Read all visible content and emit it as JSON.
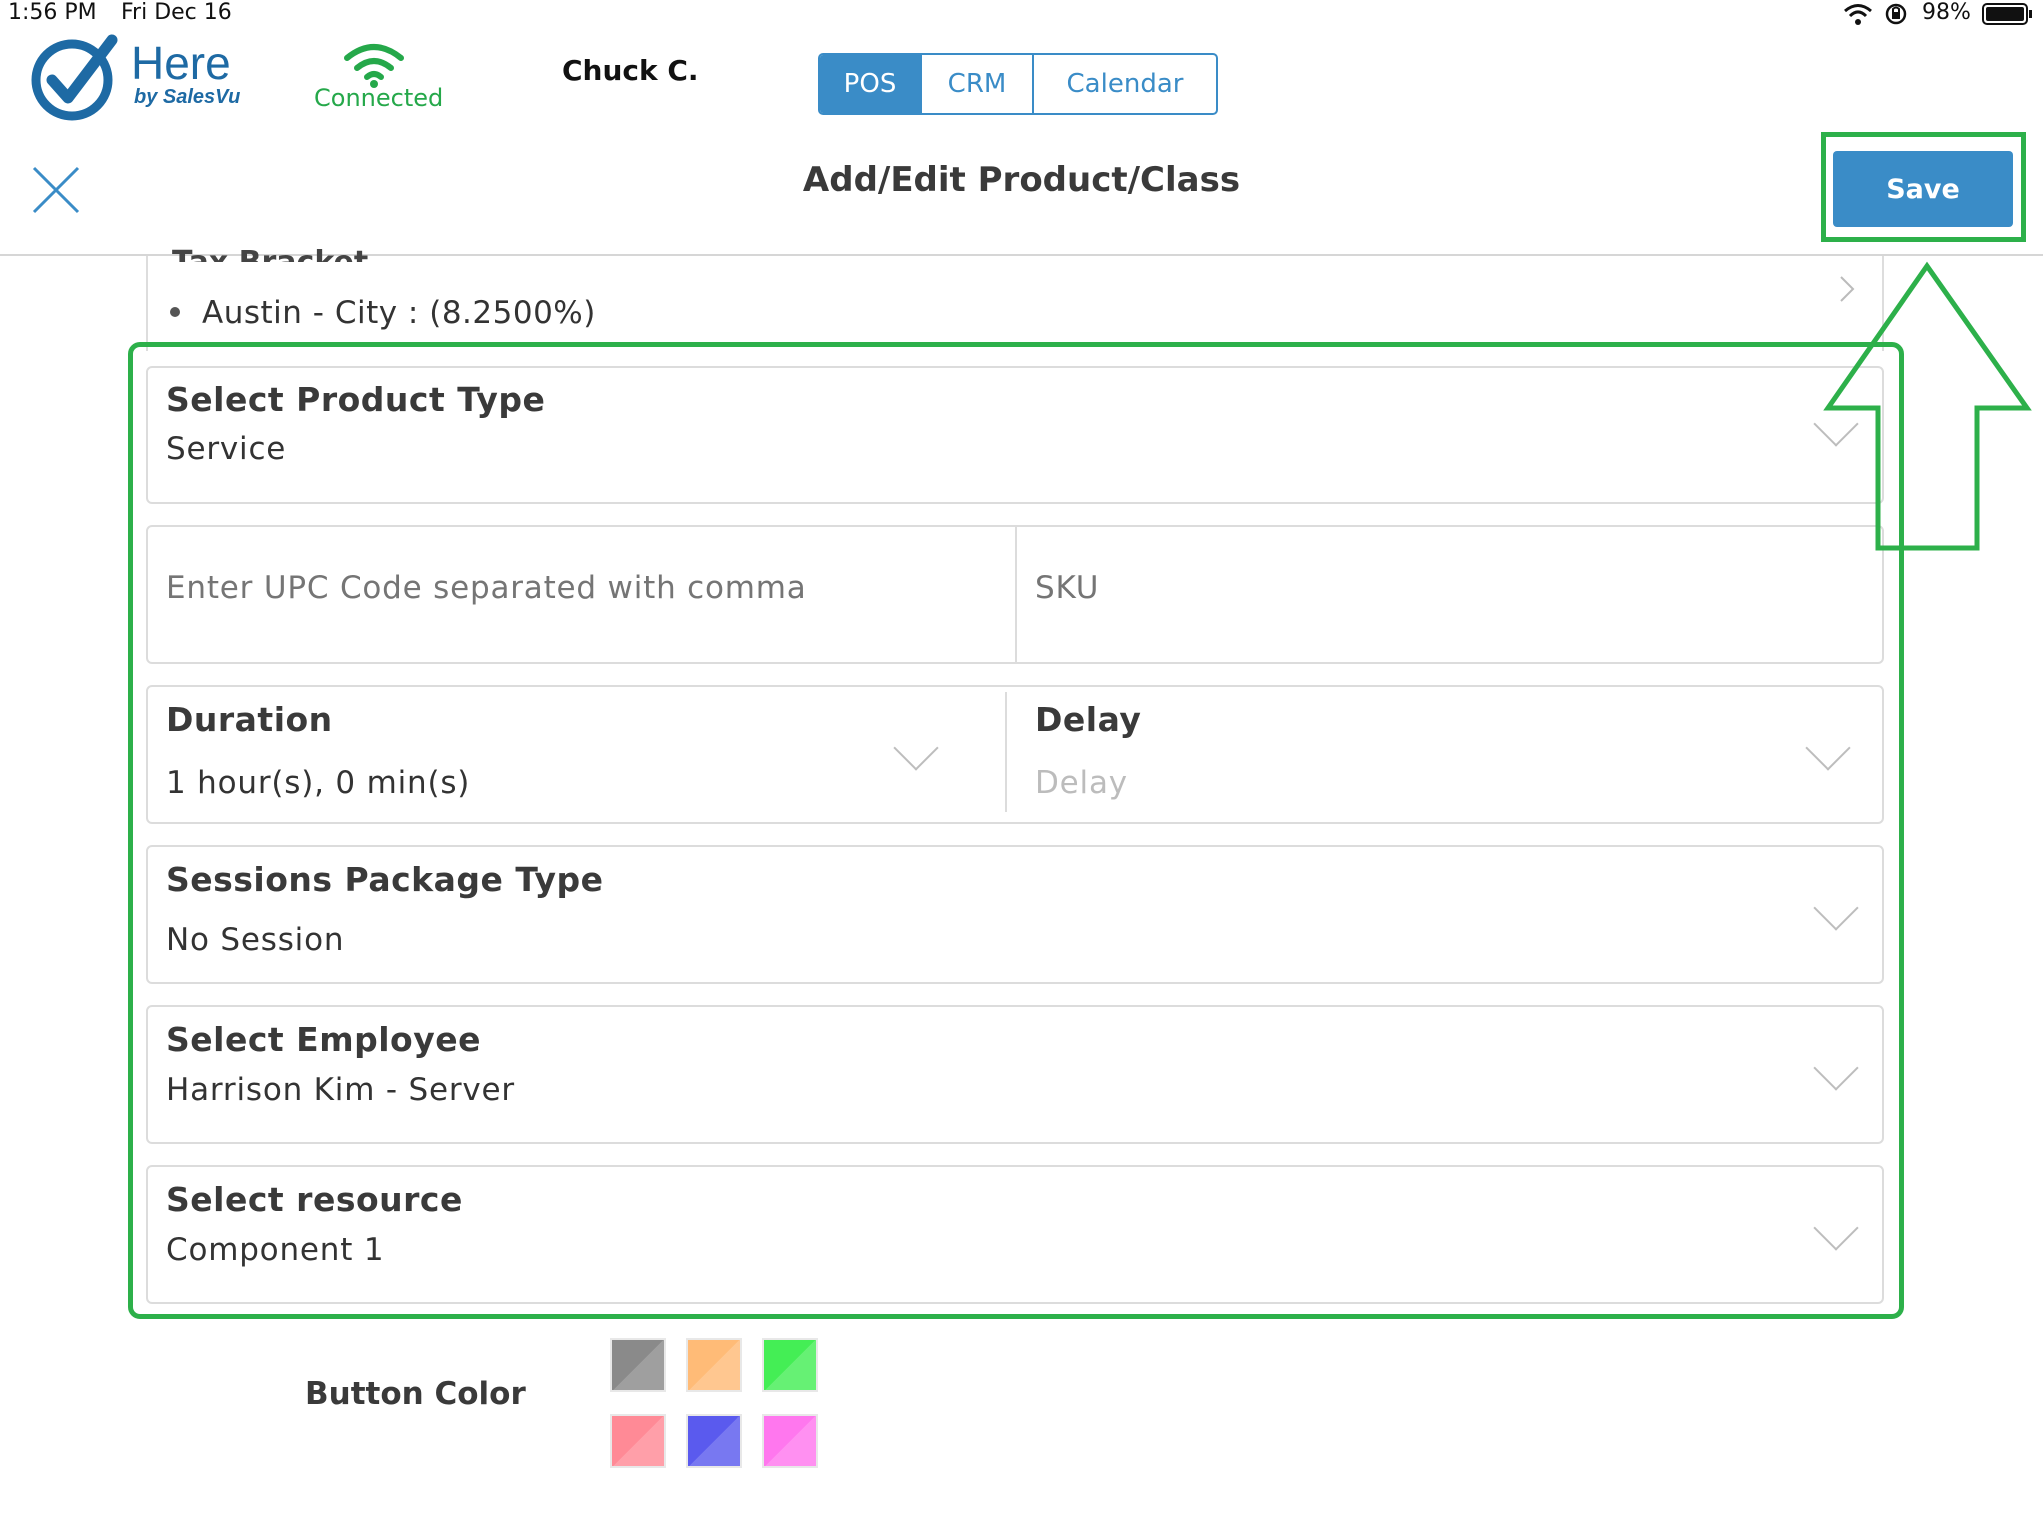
{
  "status_bar": {
    "time": "1:56 PM",
    "date": "Fri Dec 16",
    "battery": "98%"
  },
  "header": {
    "logo_title": "Here",
    "logo_subtitle": "by SalesVu",
    "connection_status": "Connected",
    "user_name": "Chuck C.",
    "tabs": [
      {
        "label": "POS",
        "active": true
      },
      {
        "label": "CRM",
        "active": false
      },
      {
        "label": "Calendar",
        "active": false
      }
    ]
  },
  "toolbar": {
    "title": "Add/Edit Product/Class",
    "save_label": "Save"
  },
  "tax": {
    "label": "Tax Bracket",
    "value": "Austin - City : (8.2500%)"
  },
  "form": {
    "product_type": {
      "label": "Select Product Type",
      "value": "Service"
    },
    "upc": {
      "placeholder": "Enter UPC Code separated with comma"
    },
    "sku": {
      "placeholder": "SKU"
    },
    "duration": {
      "label": "Duration",
      "value": "1 hour(s), 0 min(s)"
    },
    "delay": {
      "label": "Delay",
      "placeholder": "Delay"
    },
    "sessions_package": {
      "label": "Sessions Package Type",
      "value": "No Session"
    },
    "employee": {
      "label": "Select Employee",
      "value": "Harrison Kim - Server"
    },
    "resource": {
      "label": "Select resource",
      "value": "Component 1"
    }
  },
  "button_color": {
    "label": "Button Color",
    "swatches": [
      {
        "name": "gray",
        "color": "#8a8a8a"
      },
      {
        "name": "orange",
        "color": "#ffbb77"
      },
      {
        "name": "green",
        "color": "#44ee55"
      },
      {
        "name": "pink",
        "color": "#ff8a96"
      },
      {
        "name": "blue",
        "color": "#5a5aee"
      },
      {
        "name": "magenta",
        "color": "#ff77ee"
      }
    ]
  },
  "colors": {
    "accent": "#3a8cc7",
    "highlight": "#2db04a"
  }
}
